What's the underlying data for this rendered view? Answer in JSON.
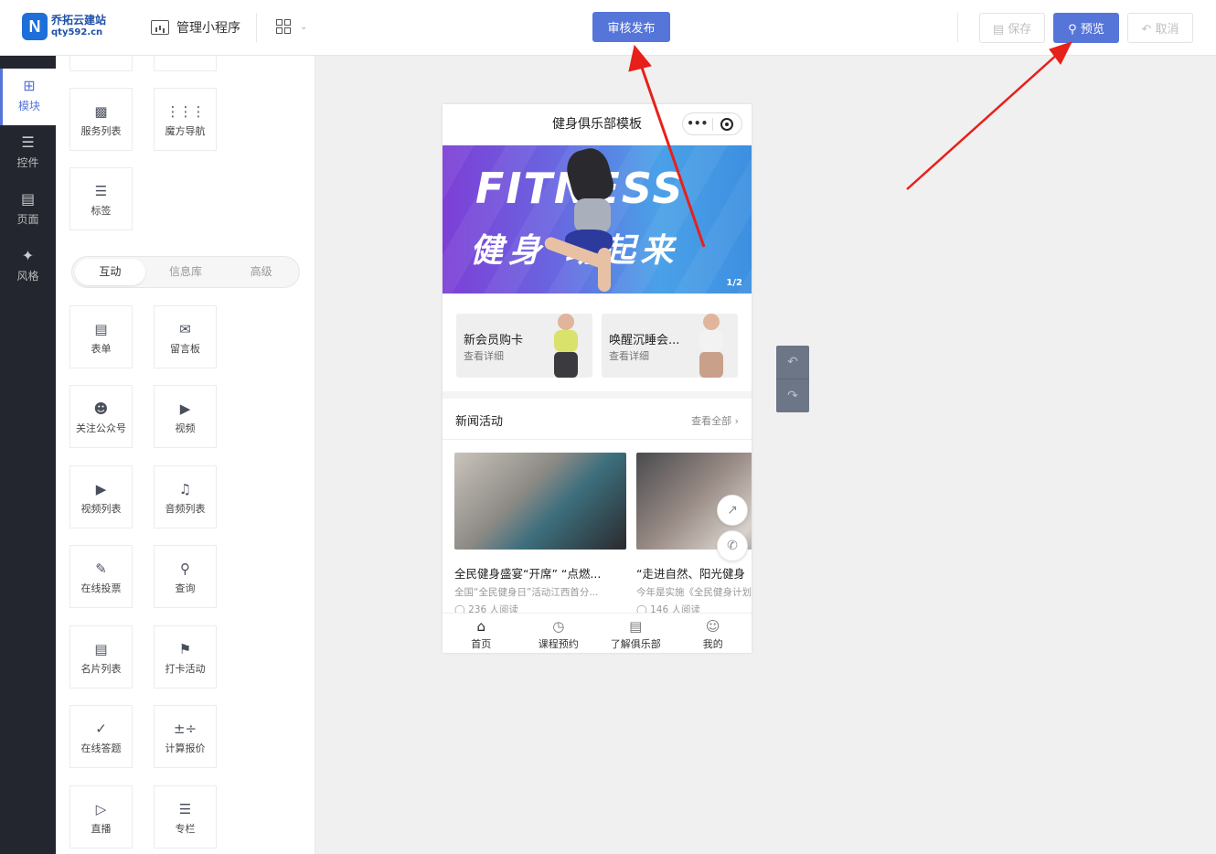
{
  "logo": {
    "line1": "乔拓云建站",
    "line2": "qty592.cn"
  },
  "topbar": {
    "manage_label": "管理小程序",
    "publish_label": "审核发布",
    "save_label": "保存",
    "preview_label": "预览",
    "cancel_label": "取消"
  },
  "rail": [
    {
      "label": "模块",
      "icon": "plus-square-icon"
    },
    {
      "label": "控件",
      "icon": "sliders-icon"
    },
    {
      "label": "页面",
      "icon": "page-icon"
    },
    {
      "label": "风格",
      "icon": "magic-wand-icon"
    }
  ],
  "panel": {
    "top_tiles": [
      {
        "label": "服务列表",
        "icon": "service-list-icon"
      },
      {
        "label": "魔方导航",
        "icon": "grid-dots-icon"
      },
      {
        "label": "标签",
        "icon": "tag-icon"
      }
    ],
    "tabs": [
      "互动",
      "信息库",
      "高级"
    ],
    "tiles": [
      {
        "label": "表单",
        "icon": "form-icon"
      },
      {
        "label": "留言板",
        "icon": "message-board-icon"
      },
      {
        "label": "关注公众号",
        "icon": "follow-icon"
      },
      {
        "label": "视频",
        "icon": "video-icon"
      },
      {
        "label": "视频列表",
        "icon": "video-list-icon"
      },
      {
        "label": "音频列表",
        "icon": "audio-list-icon"
      },
      {
        "label": "在线投票",
        "icon": "vote-icon"
      },
      {
        "label": "查询",
        "icon": "query-icon"
      },
      {
        "label": "名片列表",
        "icon": "card-list-icon"
      },
      {
        "label": "打卡活动",
        "icon": "checkin-icon"
      },
      {
        "label": "在线答题",
        "icon": "quiz-icon"
      },
      {
        "label": "计算报价",
        "icon": "calculator-icon"
      },
      {
        "label": "直播",
        "icon": "live-icon"
      },
      {
        "label": "专栏",
        "icon": "column-icon"
      }
    ]
  },
  "phone": {
    "title": "健身俱乐部模板",
    "banner": {
      "text1": "FITNESS",
      "text2": "健身 动起来",
      "pager": "1/2"
    },
    "cards": [
      {
        "title": "新会员购卡",
        "sub": "查看详细"
      },
      {
        "title": "唤醒沉睡会...",
        "sub": "查看详细"
      }
    ],
    "news_heading": "新闻活动",
    "news_more": "查看全部",
    "news": [
      {
        "title": "全民健身盛宴“开席” “点燃...",
        "desc": "全国“全民健身日”活动江西首分...",
        "reads": "236 人阅读"
      },
      {
        "title": "“走进自然、阳光健身",
        "desc": "今年是实施《全民健身计划",
        "reads": "146 人阅读"
      }
    ],
    "tabbar": [
      {
        "label": "首页",
        "icon": "home-icon"
      },
      {
        "label": "课程预约",
        "icon": "clock-icon"
      },
      {
        "label": "了解俱乐部",
        "icon": "document-icon"
      },
      {
        "label": "我的",
        "icon": "user-icon"
      }
    ]
  },
  "colors": {
    "accent": "#5675d8",
    "rail_bg": "#23262e",
    "arrow": "#e8201a"
  }
}
